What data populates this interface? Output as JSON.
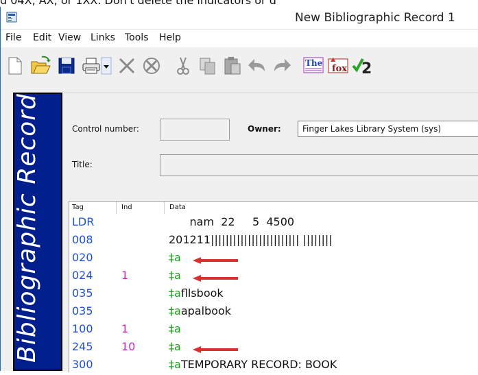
{
  "caption": "d 04X, AX, or 1XX. Don't delete the indicators or d",
  "window": {
    "title": "New Bibliographic Record 1"
  },
  "menu": [
    "File",
    "Edit",
    "View",
    "Links",
    "Tools",
    "Help"
  ],
  "toolbar": {
    "icons": [
      "new-document-icon",
      "open-folder-icon",
      "save-icon",
      "print-icon",
      "dropdown-arrow-icon",
      "delete-x-icon",
      "cancel-x-icon",
      "cut-icon",
      "copy-icon",
      "paste-icon",
      "undo-icon",
      "redo-icon",
      "thesaurus-icon",
      "fox-icon",
      "spellcheck-icon"
    ],
    "thesaurus_text": "The",
    "fox_text": "fox",
    "spell_text": "2"
  },
  "sidebar": {
    "label": "Bibliographic Record"
  },
  "header": {
    "control_number_label": "Control number:",
    "control_number_value": "",
    "owner_label": "Owner:",
    "owner_value": "Finger Lakes Library System (sys)",
    "title_label": "Title:",
    "title_value": ""
  },
  "grid": {
    "columns": [
      "Tag",
      "Ind",
      "Data"
    ],
    "rows": [
      {
        "tag": "LDR",
        "ind": "",
        "data": "      nam  22     5  4500",
        "arrow": false,
        "color": "#111111"
      },
      {
        "tag": "008",
        "ind": "",
        "data": "201211|||||||||||||||||||||||| ||||||||",
        "arrow": false,
        "color": "#111111"
      },
      {
        "tag": "020",
        "ind": "",
        "data": "‡a",
        "arrow": true,
        "color": "#1aa31a"
      },
      {
        "tag": "024",
        "ind": "1",
        "data": "‡a",
        "arrow": true,
        "color": "#1aa31a"
      },
      {
        "tag": "035",
        "ind": "",
        "data": "‡afllsbook",
        "arrow": false,
        "color": "#111111"
      },
      {
        "tag": "035",
        "ind": "",
        "data": "‡aapalbook",
        "arrow": false,
        "color": "#111111"
      },
      {
        "tag": "100",
        "ind": "1",
        "data": "‡a",
        "arrow": false,
        "color": "#1aa31a"
      },
      {
        "tag": "245",
        "ind": "10",
        "data": "‡a",
        "arrow": true,
        "color": "#1aa31a"
      },
      {
        "tag": "300",
        "ind": "",
        "data": "‡aTEMPORARY RECORD: BOOK",
        "arrow": false,
        "color": "#111111"
      }
    ]
  },
  "colors": {
    "tag": "#1f4fd6",
    "indicator": "#d01fc7",
    "subfield": "#1aa31a",
    "arrow": "#d9322e",
    "sidebar": "#001f8c"
  }
}
